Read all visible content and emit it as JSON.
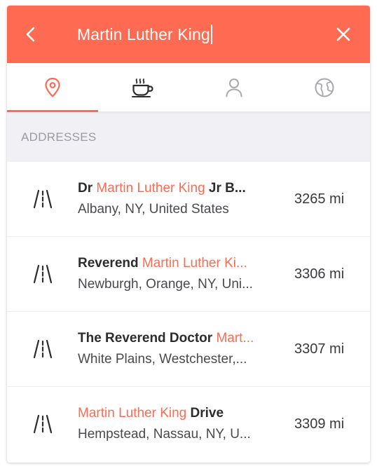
{
  "search": {
    "query": "Martin Luther King"
  },
  "tabs": [
    {
      "icon": "location-pin-icon",
      "active": true
    },
    {
      "icon": "coffee-cup-icon",
      "active": false
    },
    {
      "icon": "person-icon",
      "active": false
    },
    {
      "icon": "globe-icon",
      "active": false
    }
  ],
  "section": {
    "title": "ADDRESSES"
  },
  "results": [
    {
      "pre": "Dr ",
      "highlight": "Martin Luther King",
      "post": " Jr B...",
      "subtitle": "Albany, NY, United States",
      "distance": "3265 mi"
    },
    {
      "pre": "Reverend ",
      "highlight": "Martin Luther Ki...",
      "post": "",
      "subtitle": "Newburgh, Orange, NY, Uni...",
      "distance": "3306 mi"
    },
    {
      "pre": "The Reverend Doctor ",
      "highlight": "Mart...",
      "post": "",
      "subtitle": "White Plains, Westchester,...",
      "distance": "3307 mi"
    },
    {
      "pre": "",
      "highlight": "Martin Luther King",
      "post": " Drive",
      "subtitle": "Hempstead, Nassau, NY, U...",
      "distance": "3309 mi"
    }
  ],
  "colors": {
    "accent": "#ff6a52",
    "header_bg": "#f1f1f5",
    "text_dark": "#2c2c2e"
  }
}
